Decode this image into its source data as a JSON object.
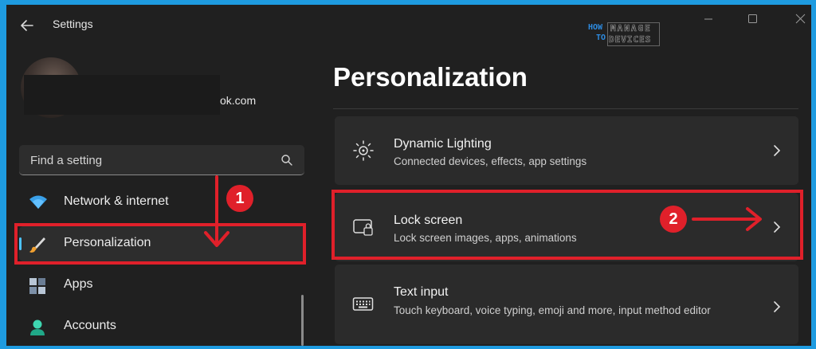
{
  "window": {
    "title": "Settings",
    "controls": [
      "minimize-icon",
      "maximize-icon",
      "close-icon"
    ]
  },
  "logo": {
    "how": "HOW",
    "to": "TO",
    "manage": "MANAGE",
    "devices": "DEVICES"
  },
  "account": {
    "email_suffix": "ok.com"
  },
  "search": {
    "placeholder": "Find a setting"
  },
  "sidebar": {
    "items": [
      {
        "label": "Network & internet",
        "icon": "wifi-icon"
      },
      {
        "label": "Personalization",
        "icon": "paintbrush-icon",
        "selected": true
      },
      {
        "label": "Apps",
        "icon": "apps-icon"
      },
      {
        "label": "Accounts",
        "icon": "person-icon"
      }
    ]
  },
  "main": {
    "title": "Personalization",
    "cards": [
      {
        "title": "Dynamic Lighting",
        "subtitle": "Connected devices, effects, app settings",
        "icon": "dynamic-lighting-icon"
      },
      {
        "title": "Lock screen",
        "subtitle": "Lock screen images, apps, animations",
        "icon": "lock-screen-icon"
      },
      {
        "title": "Text input",
        "subtitle": "Touch keyboard, voice typing, emoji and more, input method editor",
        "icon": "keyboard-icon"
      }
    ]
  },
  "annotations": {
    "step1": "1",
    "step2": "2",
    "color": "#e0202a"
  },
  "colors": {
    "accent": "#4cc2ff",
    "background": "#202020",
    "card": "#2b2b2b"
  }
}
